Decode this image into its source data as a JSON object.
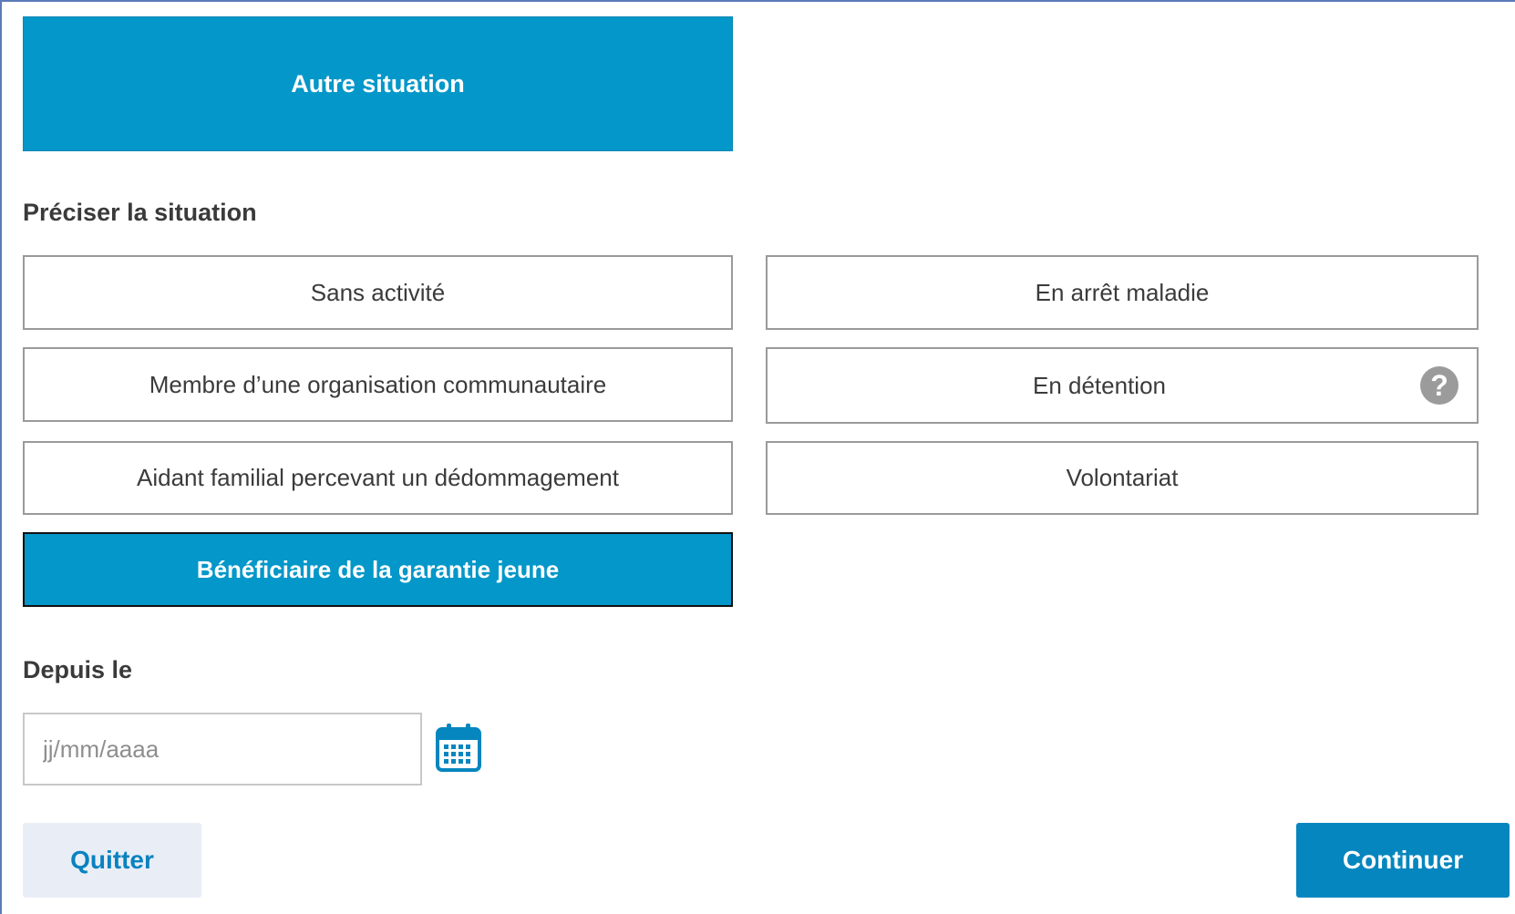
{
  "main_choice": {
    "label": "Autre situation"
  },
  "situation": {
    "label": "Préciser la situation",
    "options": [
      {
        "label": "Sans activité"
      },
      {
        "label": "En arrêt maladie"
      },
      {
        "label": "Membre d’une organisation communautaire"
      },
      {
        "label": "En détention",
        "help_icon": "question-circle-icon"
      },
      {
        "label": "Aidant familial percevant un dédommagement"
      },
      {
        "label": "Volontariat"
      },
      {
        "label": "Bénéficiaire de la garantie jeune",
        "selected": true
      }
    ]
  },
  "date": {
    "label": "Depuis le",
    "value": "",
    "placeholder": "jj/mm/aaaa",
    "icon": "calendar-icon"
  },
  "actions": {
    "quit_label": "Quitter",
    "continue_label": "Continuer"
  },
  "colors": {
    "accent": "#0497c9",
    "continue_button": "#0586bf",
    "quit_button_bg": "#e9eef6",
    "quit_button_text": "#0a82c0"
  }
}
